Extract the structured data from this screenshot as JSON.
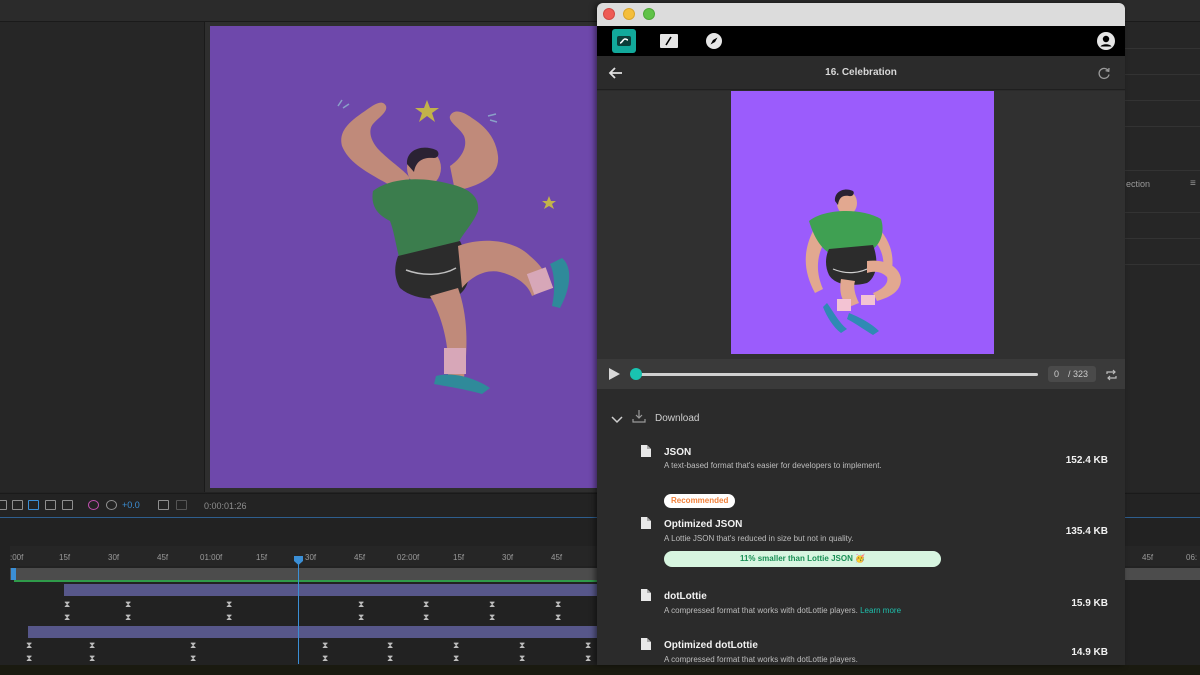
{
  "ae": {
    "right_panel_label": "ection",
    "toolbar": {
      "exposure": "+0.0",
      "timecode": "0:00:01:26"
    },
    "ruler_ticks": [
      ":00f",
      "15f",
      "30f",
      "45f",
      "01:00f",
      "15f",
      "30f",
      "45f",
      "02:00f",
      "15f",
      "30f",
      "45f"
    ],
    "ruler_ticks_right": [
      "45f",
      "06:"
    ]
  },
  "plugin": {
    "title": "16. Celebration",
    "nav_icons": [
      "lottie-logo-icon",
      "edit-icon",
      "compass-icon",
      "account-icon"
    ],
    "player": {
      "current_frame": "0",
      "total_frames": "/ 323",
      "progress": 0
    },
    "download": {
      "title": "Download",
      "options": [
        {
          "name": "JSON",
          "desc": "A text-based format that's easier for developers to implement.",
          "size": "152.4 KB"
        },
        {
          "badge": "Recommended",
          "name": "Optimized JSON",
          "desc": "A Lottie JSON that's reduced in size but not in quality.",
          "size": "135.4 KB",
          "savings": "11% smaller than Lottie JSON 🥳"
        },
        {
          "name": "dotLottie",
          "desc": "A compressed format that works with dotLottie players.",
          "link": "Learn more",
          "size": "15.9 KB"
        },
        {
          "name": "Optimized dotLottie",
          "desc": "A compressed format that works with dotLottie players.",
          "size": "14.9 KB"
        }
      ]
    }
  },
  "colors": {
    "accent_teal": "#19c3b0",
    "comp_bg": "#6e48ab",
    "preview_bg": "#9b5cfc",
    "recommended": "#f0813b"
  }
}
